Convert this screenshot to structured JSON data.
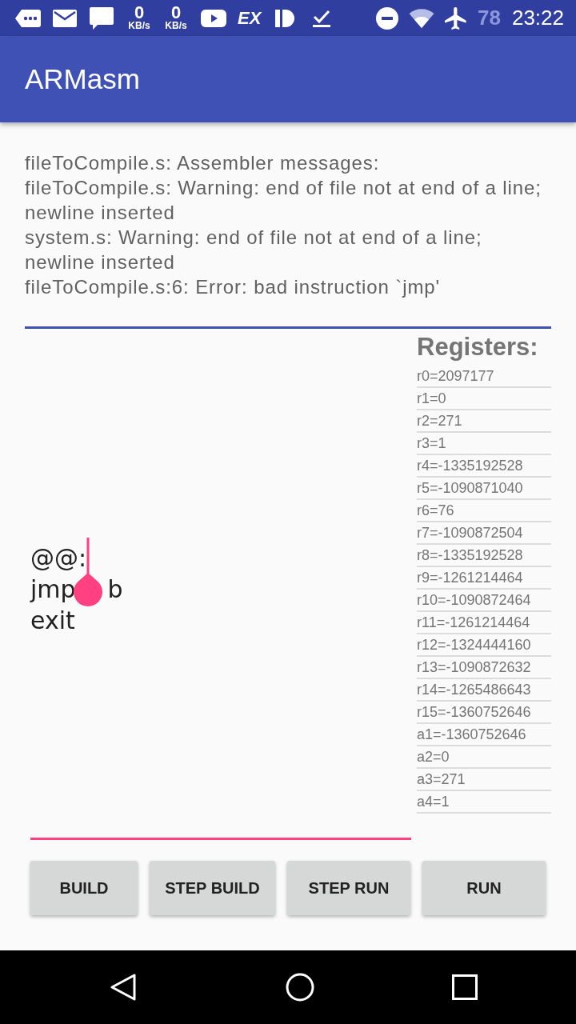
{
  "status_bar": {
    "net_speeds": [
      {
        "value": "0",
        "unit": "KB/s"
      },
      {
        "value": "0",
        "unit": "KB/s"
      }
    ],
    "app_badge": "EX",
    "battery": "78",
    "time": "23:22"
  },
  "app_bar": {
    "title": "ARMasm"
  },
  "compiler_output": [
    "fileToCompile.s: Assembler messages:",
    "fileToCompile.s: Warning: end of file not at end of a line; newline inserted",
    "system.s: Warning: end of file not at end of a line; newline inserted",
    "fileToCompile.s:6: Error: bad instruction `jmp'"
  ],
  "editor": {
    "lines": [
      {
        "segments": [
          "@@:"
        ],
        "caret": true
      },
      {
        "segments": [
          "jmp",
          "b"
        ],
        "caret": false
      },
      {
        "segments": [
          "exit"
        ],
        "caret": false
      }
    ]
  },
  "registers": {
    "title": "Registers:",
    "items": [
      "r0=2097177",
      "r1=0",
      "r2=271",
      "r3=1",
      "r4=-1335192528",
      "r5=-1090871040",
      "r6=76",
      "r7=-1090872504",
      "r8=-1335192528",
      "r9=-1261214464",
      "r10=-1090872464",
      "r11=-1261214464",
      "r12=-1324444160",
      "r13=-1090872632",
      "r14=-1265486643",
      "r15=-1360752646",
      "a1=-1360752646",
      "a2=0",
      "a3=271",
      "a4=1"
    ]
  },
  "buttons": [
    "BUILD",
    "STEP BUILD",
    "STEP RUN",
    "RUN"
  ]
}
